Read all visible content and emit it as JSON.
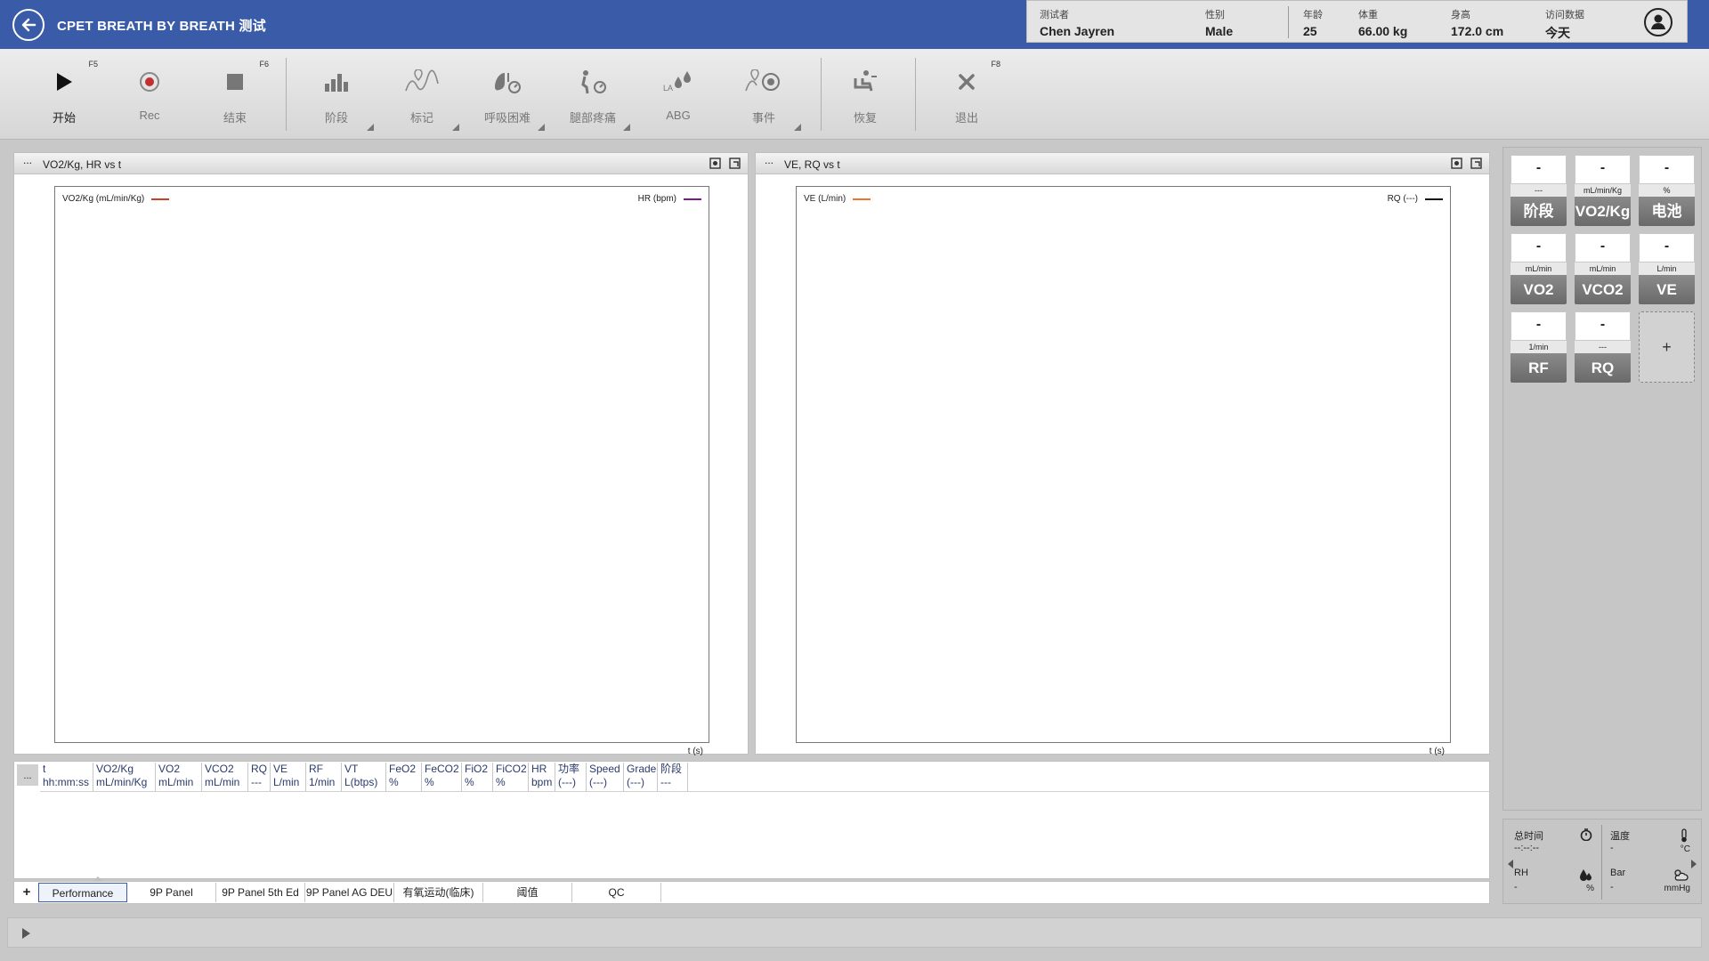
{
  "header": {
    "title": "CPET BREATH BY BREATH 测试",
    "accent": "#3a5ba8",
    "patient": {
      "tester_label": "测试者",
      "tester_value": "Chen Jayren",
      "sex_label": "性别",
      "sex_value": "Male",
      "age_label": "年龄",
      "age_value": "25",
      "weight_label": "体重",
      "weight_value": "66.00 kg",
      "height_label": "身高",
      "height_value": "172.0 cm",
      "visit_label": "访问数据",
      "visit_value": "今天"
    }
  },
  "toolbar": {
    "start": {
      "label": "开始",
      "key": "F5"
    },
    "rec": {
      "label": "Rec"
    },
    "end": {
      "label": "结束",
      "key": "F6"
    },
    "phase": {
      "label": "阶段"
    },
    "marker": {
      "label": "标记"
    },
    "dyspnea": {
      "label": "呼吸困难"
    },
    "leg_pain": {
      "label": "腿部疼痛"
    },
    "abg": {
      "label": "ABG"
    },
    "event": {
      "label": "事件"
    },
    "recovery": {
      "label": "恢复"
    },
    "exit": {
      "label": "退出",
      "key": "F8"
    }
  },
  "charts": {
    "left": {
      "menu": "...",
      "title": "VO2/Kg, HR vs t",
      "legend_left": "VO2/Kg (mL/min/Kg)",
      "legend_left_color": "#d04020",
      "legend_right": "HR (bpm)",
      "legend_right_color": "#7a1a8a",
      "x_label": "t (s)"
    },
    "right": {
      "menu": "...",
      "title": "VE, RQ vs t",
      "legend_left": "VE (L/min)",
      "legend_left_color": "#f07030",
      "legend_right": "RQ (---)",
      "legend_right_color": "#111111",
      "x_label": "t (s)"
    }
  },
  "tiles": [
    {
      "value": "-",
      "unit": "---",
      "label": "阶段"
    },
    {
      "value": "-",
      "unit": "mL/min/Kg",
      "label": "VO2/Kg"
    },
    {
      "value": "-",
      "unit": "%",
      "label": "电池"
    },
    {
      "value": "-",
      "unit": "mL/min",
      "label": "VO2"
    },
    {
      "value": "-",
      "unit": "mL/min",
      "label": "VCO2"
    },
    {
      "value": "-",
      "unit": "L/min",
      "label": "VE"
    },
    {
      "value": "-",
      "unit": "1/min",
      "label": "RF"
    },
    {
      "value": "-",
      "unit": "---",
      "label": "RQ"
    }
  ],
  "tile_add": "+",
  "environment": {
    "total_time": {
      "label": "总时间",
      "value": "--:--:--"
    },
    "temperature": {
      "label": "温度",
      "value": "-",
      "unit": "°C"
    },
    "rh": {
      "label": "RH",
      "value": "-",
      "unit": "%"
    },
    "bar": {
      "label": "Bar",
      "value": "-",
      "unit": "mmHg"
    }
  },
  "table": {
    "menu": "...",
    "columns": [
      {
        "name": "t",
        "unit": "hh:mm:ss"
      },
      {
        "name": "VO2/Kg",
        "unit": "mL/min/Kg"
      },
      {
        "name": "VO2",
        "unit": "mL/min"
      },
      {
        "name": "VCO2",
        "unit": "mL/min"
      },
      {
        "name": "RQ",
        "unit": "---"
      },
      {
        "name": "VE",
        "unit": "L/min"
      },
      {
        "name": "RF",
        "unit": "1/min"
      },
      {
        "name": "VT",
        "unit": "L(btps)"
      },
      {
        "name": "FeO2",
        "unit": "%"
      },
      {
        "name": "FeCO2",
        "unit": "%"
      },
      {
        "name": "FiO2",
        "unit": "%"
      },
      {
        "name": "FiCO2",
        "unit": "%"
      },
      {
        "name": "HR",
        "unit": "bpm"
      },
      {
        "name": "功率",
        "unit": "(---)"
      },
      {
        "name": "Speed",
        "unit": "(---)"
      },
      {
        "name": "Grade",
        "unit": "(---)"
      },
      {
        "name": "阶段",
        "unit": "---"
      }
    ]
  },
  "tabs": {
    "add": "+",
    "items": [
      "Performance",
      "9P Panel",
      "9P Panel 5th Ed",
      "9P Panel AG DEU",
      "有氧运动(临床)",
      "阈值",
      "QC"
    ],
    "active": "Performance"
  }
}
